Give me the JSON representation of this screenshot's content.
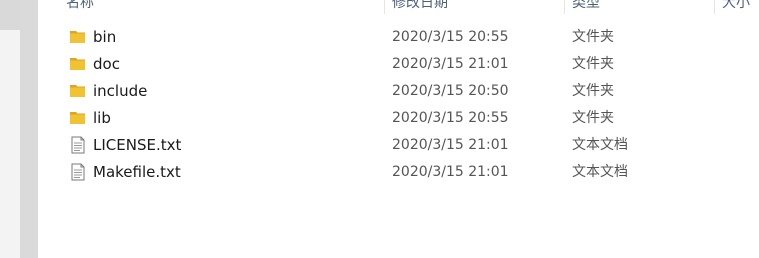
{
  "columns": {
    "name": "名称",
    "modified": "修改日期",
    "type": "类型",
    "size": "大小"
  },
  "files": [
    {
      "name": "bin",
      "modified": "2020/3/15 20:55",
      "type": "文件夹",
      "icon": "folder-icon"
    },
    {
      "name": "doc",
      "modified": "2020/3/15 21:01",
      "type": "文件夹",
      "icon": "folder-icon"
    },
    {
      "name": "include",
      "modified": "2020/3/15 20:50",
      "type": "文件夹",
      "icon": "folder-icon"
    },
    {
      "name": "lib",
      "modified": "2020/3/15 20:55",
      "type": "文件夹",
      "icon": "folder-icon"
    },
    {
      "name": "LICENSE.txt",
      "modified": "2020/3/15 21:01",
      "type": "文本文档",
      "icon": "text-file-icon"
    },
    {
      "name": "Makefile.txt",
      "modified": "2020/3/15 21:01",
      "type": "文本文档",
      "icon": "text-file-icon"
    }
  ],
  "colors": {
    "folder": "#f1c232",
    "folder_dark": "#dfa51e",
    "header_text": "#4c607a",
    "scrollbar": "#dadada"
  }
}
